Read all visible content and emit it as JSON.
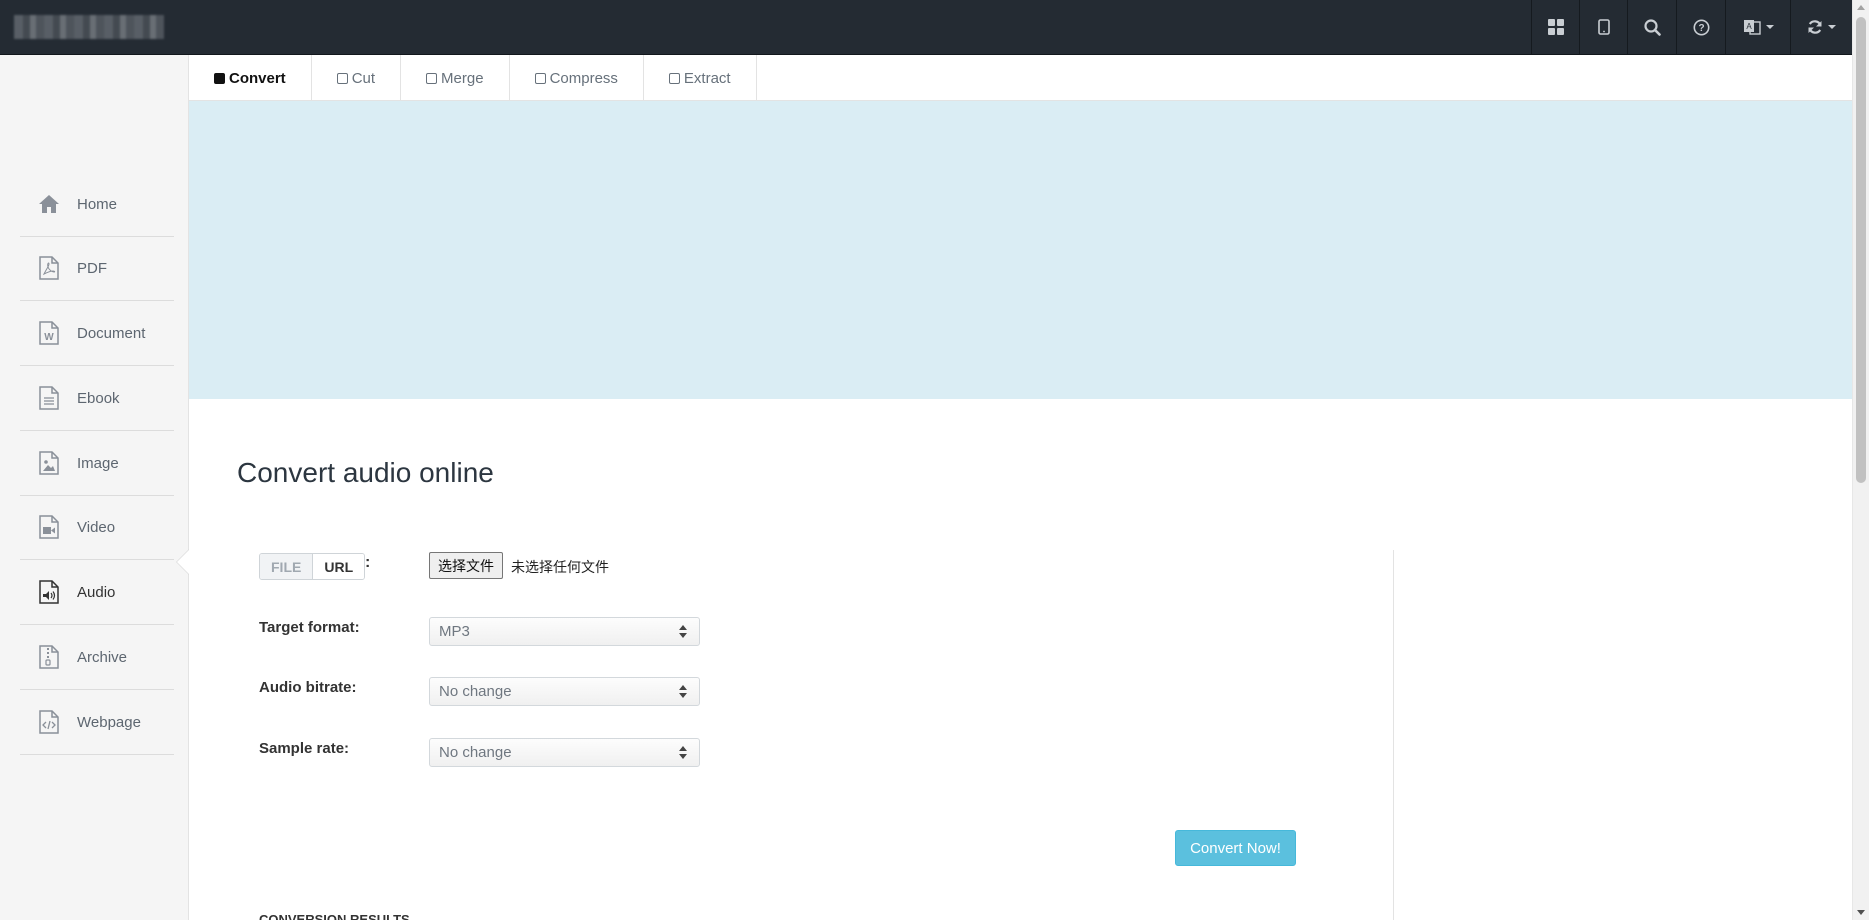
{
  "topbar": {
    "icons": [
      "grid-icon",
      "tablet-icon",
      "search-icon",
      "help-icon",
      "language-icon",
      "refresh-icon"
    ]
  },
  "sidebar": {
    "items": [
      {
        "label": "Home",
        "icon": "home-icon"
      },
      {
        "label": "PDF",
        "icon": "pdf-file-icon"
      },
      {
        "label": "Document",
        "icon": "word-file-icon"
      },
      {
        "label": "Ebook",
        "icon": "ebook-file-icon"
      },
      {
        "label": "Image",
        "icon": "image-file-icon"
      },
      {
        "label": "Video",
        "icon": "video-file-icon"
      },
      {
        "label": "Audio",
        "icon": "audio-file-icon",
        "active": true
      },
      {
        "label": "Archive",
        "icon": "archive-file-icon"
      },
      {
        "label": "Webpage",
        "icon": "code-file-icon"
      }
    ]
  },
  "tabs": [
    {
      "label": "Convert",
      "active": true
    },
    {
      "label": "Cut"
    },
    {
      "label": "Merge"
    },
    {
      "label": "Compress"
    },
    {
      "label": "Extract"
    }
  ],
  "main": {
    "title": "Convert audio online",
    "source": {
      "file_label": "FILE",
      "url_label": "URL",
      "colon": ":"
    },
    "file_input": {
      "button_label": "选择文件",
      "status": "未选择任何文件"
    },
    "fields": [
      {
        "label": "Target format:",
        "value": "MP3"
      },
      {
        "label": "Audio bitrate:",
        "value": "No change"
      },
      {
        "label": "Sample rate:",
        "value": "No change"
      }
    ],
    "convert_button": "Convert Now!",
    "results_heading": "CONVERSION RESULTS"
  },
  "colors": {
    "topbar": "#242b33",
    "banner": "#daedf4",
    "convert_button": "#5bc0de"
  }
}
